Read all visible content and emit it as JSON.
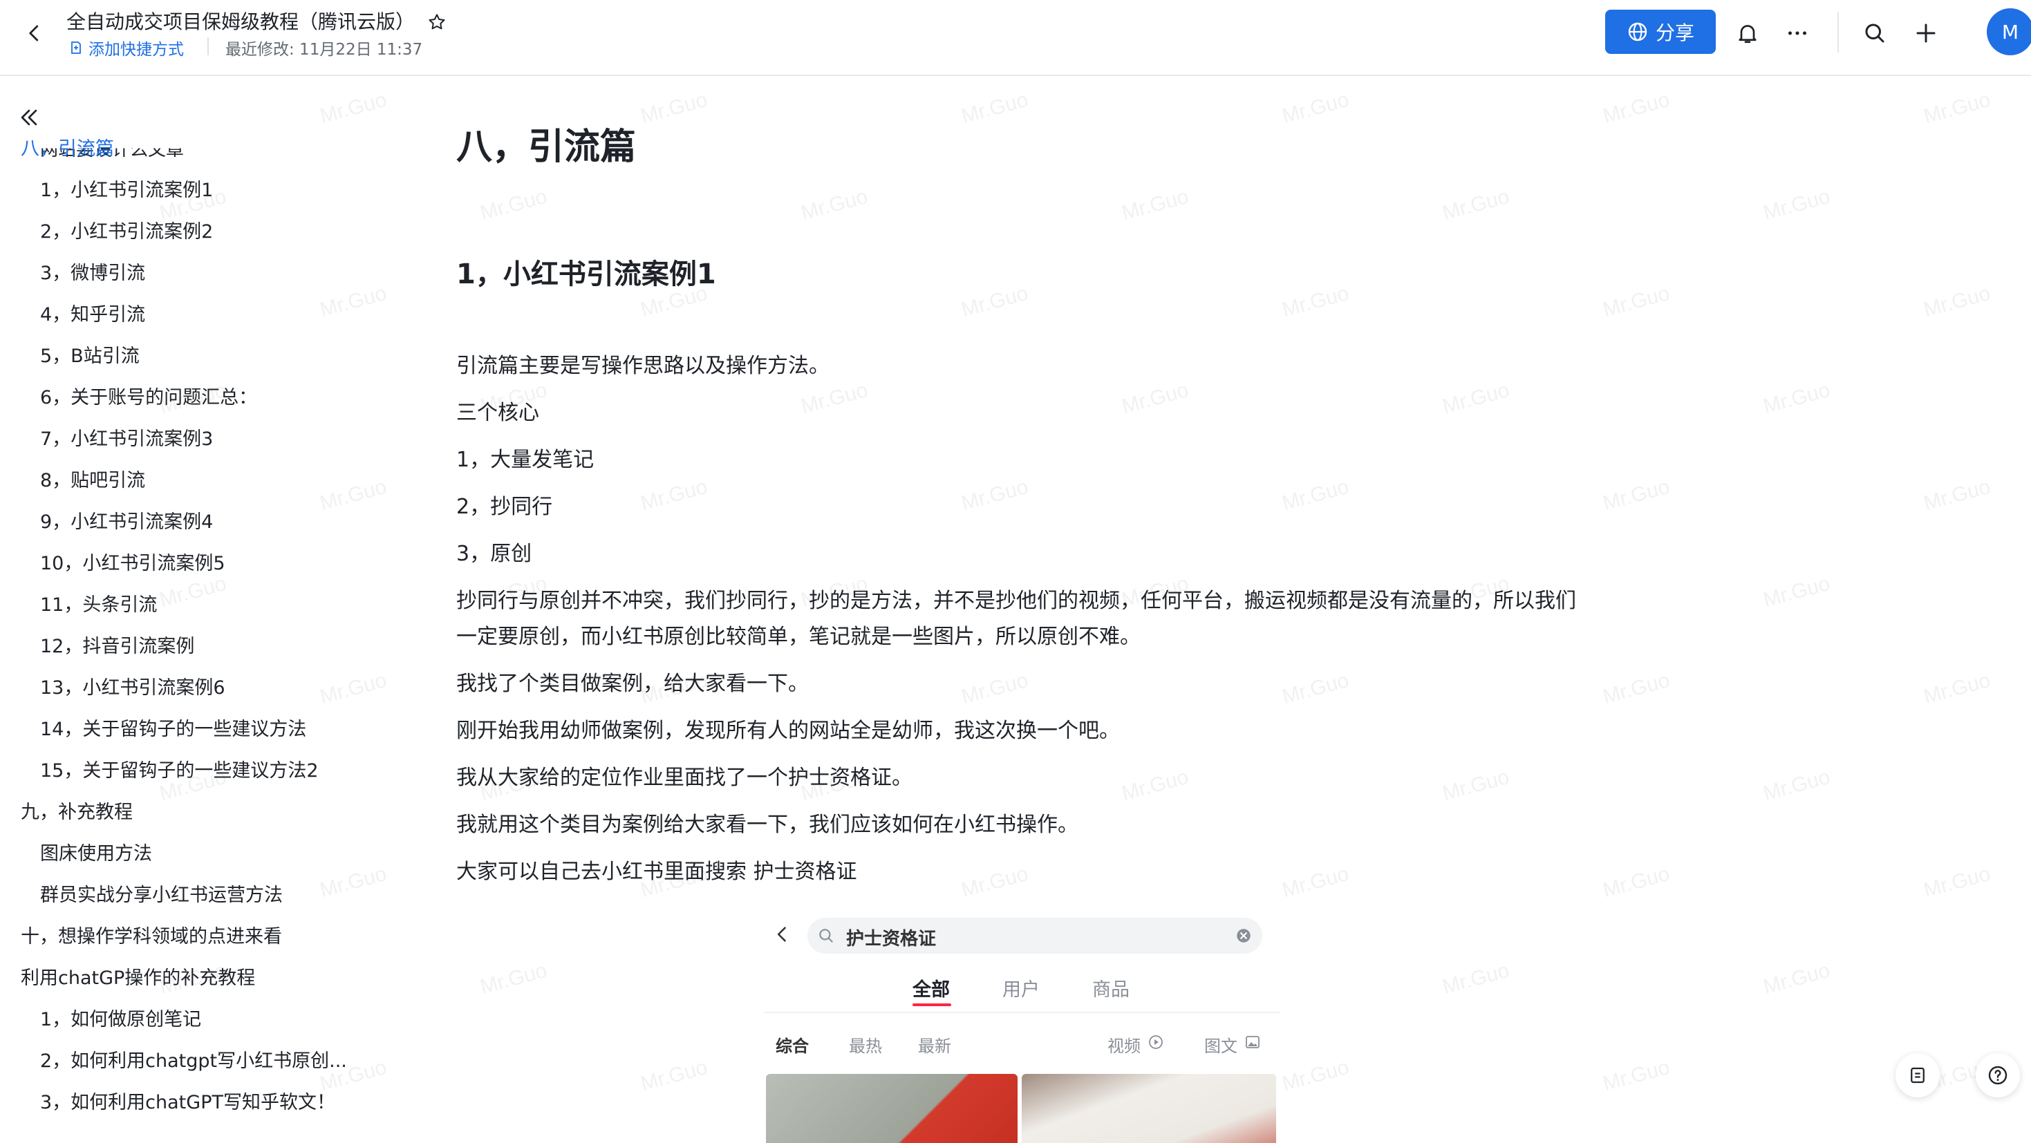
{
  "header": {
    "doc_title": "全自动成交项目保姆级教程（腾讯云版）",
    "add_shortcut": "添加快捷方式",
    "last_modified": "最近修改: 11月22日 11:37",
    "share_label": "分享",
    "avatar_initial": "M"
  },
  "watermark": "Mr.Guo",
  "sidebar": {
    "clipped_item": "网站要设计么文章",
    "items": [
      {
        "label": "八，引流篇",
        "level": 1,
        "active": true
      },
      {
        "label": "1，小红书引流案例1",
        "level": 2
      },
      {
        "label": "2，小红书引流案例2",
        "level": 2
      },
      {
        "label": "3，微博引流",
        "level": 2
      },
      {
        "label": "4，知乎引流",
        "level": 2
      },
      {
        "label": "5，B站引流",
        "level": 2
      },
      {
        "label": "6，关于账号的问题汇总：",
        "level": 2
      },
      {
        "label": "7，小红书引流案例3",
        "level": 2
      },
      {
        "label": "8，贴吧引流",
        "level": 2
      },
      {
        "label": "9，小红书引流案例4",
        "level": 2
      },
      {
        "label": "10，小红书引流案例5",
        "level": 2
      },
      {
        "label": "11，头条引流",
        "level": 2
      },
      {
        "label": "12，抖音引流案例",
        "level": 2
      },
      {
        "label": "13，小红书引流案例6",
        "level": 2
      },
      {
        "label": "14，关于留钩子的一些建议方法",
        "level": 2
      },
      {
        "label": "15，关于留钩子的一些建议方法2",
        "level": 2
      },
      {
        "label": "九，补充教程",
        "level": 1
      },
      {
        "label": "图床使用方法",
        "level": 2
      },
      {
        "label": "群员实战分享小红书运营方法",
        "level": 2
      },
      {
        "label": "十，想操作学科领域的点进来看",
        "level": 1
      },
      {
        "label": "利用chatGP操作的补充教程",
        "level": 1
      },
      {
        "label": "1，如何做原创笔记",
        "level": 2
      },
      {
        "label": "2，如何利用chatgpt写小红书原创...",
        "level": 2
      },
      {
        "label": "3，如何利用chatGPT写知乎软文！",
        "level": 2
      }
    ]
  },
  "content": {
    "h1": "八，引流篇",
    "h2": "1，小红书引流案例1",
    "paragraphs": [
      "引流篇主要是写操作思路以及操作方法。",
      "三个核心",
      "1，大量发笔记",
      "2，抄同行",
      "3，原创",
      "抄同行与原创并不冲突，我们抄同行，抄的是方法，并不是抄他们的视频，任何平台，搬运视频都是没有流量的，所以我们一定要原创，而小红书原创比较简单，笔记就是一些图片，所以原创不难。",
      "我找了个类目做案例，给大家看一下。",
      "刚开始我用幼师做案例，发现所有人的网站全是幼师，我这次换一个吧。",
      "我从大家给的定位作业里面找了一个护士资格证。",
      "我就用这个类目为案例给大家看一下，我们应该如何在小红书操作。",
      "大家可以自己去小红书里面搜索 护士资格证"
    ]
  },
  "embedded_screenshot": {
    "search_text": "护士资格证",
    "tabs": [
      "全部",
      "用户",
      "商品"
    ],
    "filters": [
      "综合",
      "最热",
      "最新",
      "视频",
      "图文"
    ]
  }
}
